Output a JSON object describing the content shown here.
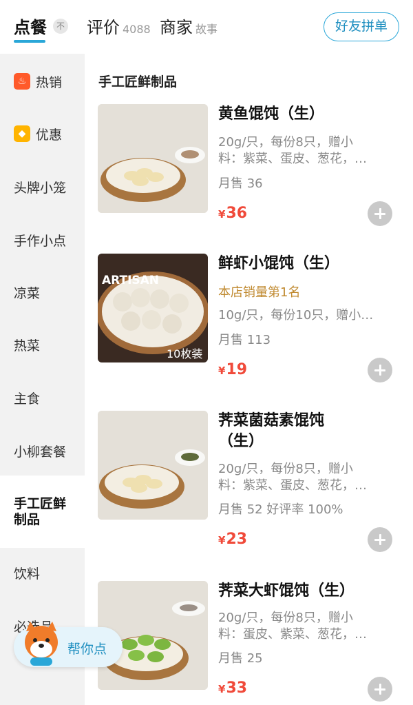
{
  "tabs": [
    {
      "label": "点餐",
      "count": "",
      "active": true
    },
    {
      "label": "评价",
      "count": "4088"
    },
    {
      "label": "商家",
      "count": "故事"
    }
  ],
  "collapse_badge": "不",
  "group_order_button": "好友拼单",
  "sidebar": {
    "items": [
      {
        "label": "热销",
        "icon": "fire-icon"
      },
      {
        "label": "优惠",
        "icon": "tag-icon"
      },
      {
        "label": "头牌小笼"
      },
      {
        "label": "手作小点"
      },
      {
        "label": "凉菜"
      },
      {
        "label": "热菜"
      },
      {
        "label": "主食"
      },
      {
        "label": "小柳套餐"
      },
      {
        "label": "手工匠鲜制品",
        "active": true
      },
      {
        "label": "饮料"
      },
      {
        "label": "必选品"
      }
    ]
  },
  "section_title": "手工匠鲜制品",
  "products": [
    {
      "name": "黄鱼馄饨（生）",
      "desc_line1": "20g/只，每份8只，赠小",
      "desc_line2": "料：紫菜、蛋皮、葱花，…",
      "sales": "月售 36",
      "price_symbol": "¥",
      "price": "36"
    },
    {
      "name": "鲜虾小馄饨（生）",
      "rank": "本店销量第1名",
      "desc_line1": "10g/只，每份10只，赠小…",
      "sales": "月售 113",
      "price_symbol": "¥",
      "price": "19",
      "image_text_1": "ARTISAN",
      "image_text_2": "10枚装"
    },
    {
      "name_line1": "荠菜菌菇素馄饨",
      "name_line2": "（生）",
      "desc_line1": "20g/只，每份8只，赠小",
      "desc_line2": "料：紫菜、蛋皮、葱花，…",
      "sales": "月售 52  好评率 100%",
      "price_symbol": "¥",
      "price": "23"
    },
    {
      "name": "荠菜大虾馄饨（生）",
      "desc_line1": "20g/只，每份8只，赠小",
      "desc_line2": "料：蛋皮、紫菜、葱花，…",
      "sales": "月售 25",
      "price_symbol": "¥",
      "price": "33"
    }
  ],
  "helper_button": "帮你点",
  "colors": {
    "accent": "#2aa7d8",
    "price": "#f04a3a",
    "rank": "#c08a30",
    "sidebar_bg": "#f2f2f2"
  }
}
